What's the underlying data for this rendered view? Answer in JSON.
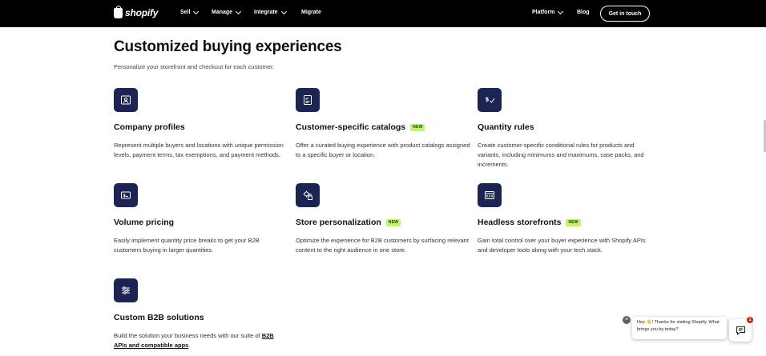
{
  "nav": {
    "logo_text": "shopify",
    "items": [
      "Sell",
      "Manage",
      "Integrate",
      "Migrate"
    ],
    "platform_label": "Platform",
    "blog_label": "Blog",
    "cta_label": "Get in touch"
  },
  "hero": {
    "title": "Customized buying experiences",
    "subtitle": "Personalize your storefront and checkout for each customer."
  },
  "features": [
    {
      "icon": "id-card-icon",
      "title": "Company profiles",
      "badge": "",
      "description": "Represent multiple buyers and locations with unique permission levels, payment terms, tax exemptions, and payment methods."
    },
    {
      "icon": "catalog-icon",
      "title": "Customer-specific catalogs",
      "badge": "NEW",
      "description": "Offer a curated buying experience with product catalogs assigned to a specific buyer or location."
    },
    {
      "icon": "dollar-check-icon",
      "title": "Quantity rules",
      "badge": "",
      "description": "Create customer-specific conditional rules for products and variants, including minimums and maximums, case packs, and increments."
    },
    {
      "icon": "price-tag-icon",
      "title": "Volume pricing",
      "badge": "",
      "description": "Easily implement quantity price breaks to get your B2B customers buying in larger quantities."
    },
    {
      "icon": "personalization-icon",
      "title": "Store personalization",
      "badge": "NEW",
      "description": "Optimize the experience for B2B customers by surfacing relevant content to the right audience in one store."
    },
    {
      "icon": "code-window-icon",
      "title": "Headless storefronts",
      "badge": "NEW",
      "description": "Gain total control over your buyer experience with Shopify APIs and developer tools along with your tech stack."
    },
    {
      "icon": "sliders-icon",
      "title": "Custom B2B solutions",
      "badge": "",
      "description_prefix": "Build the solution your business needs with our suite of ",
      "description_link": "B2B APIs and compatible apps",
      "description_suffix": "."
    }
  ],
  "chat": {
    "message": "Hey 👋! Thanks for visiting Shopify. What brings you by today?",
    "close_symbol": "×",
    "unread_count": "1"
  },
  "colors": {
    "nav_bg": "#000000",
    "icon_tile": "#1b2453",
    "badge_bg": "#c1f56c",
    "chat_badge": "#d0221c"
  }
}
